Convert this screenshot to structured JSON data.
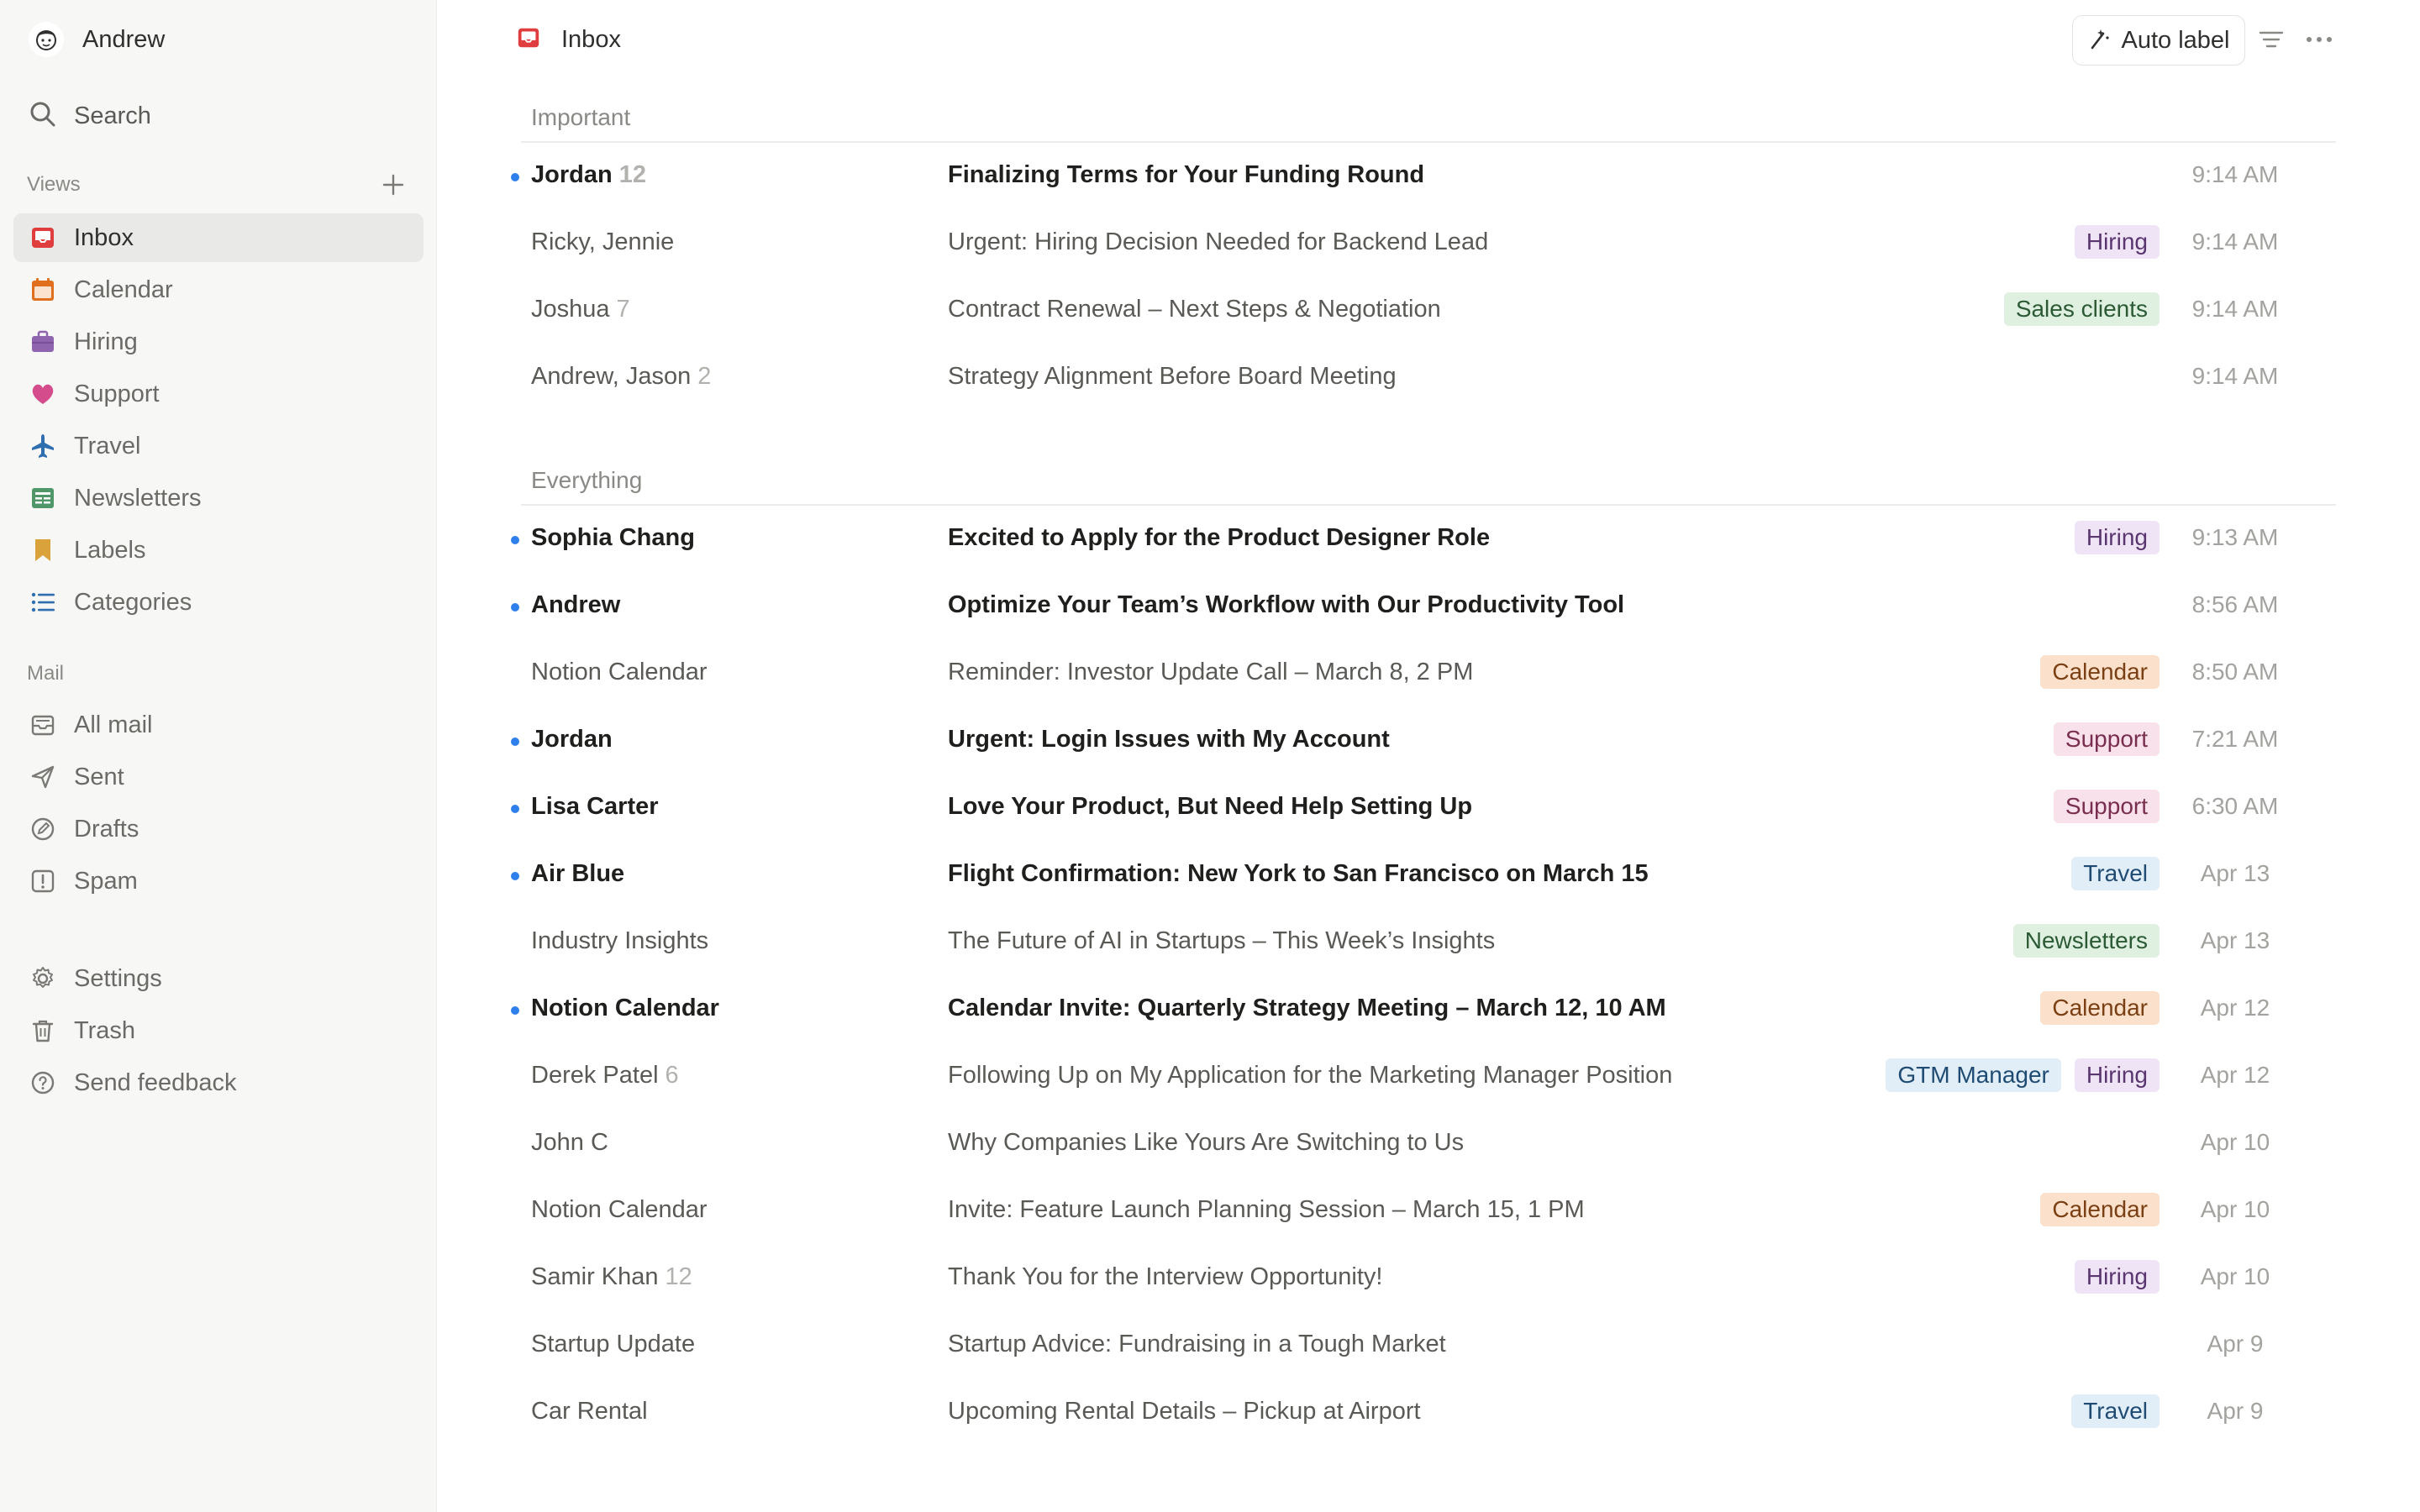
{
  "user": {
    "name": "Andrew"
  },
  "sidebar": {
    "search_label": "Search",
    "views_label": "Views",
    "mail_label": "Mail",
    "views": [
      {
        "label": "Inbox",
        "icon": "inbox-icon",
        "color": "#e03e3e",
        "active": true
      },
      {
        "label": "Calendar",
        "icon": "calendar-icon",
        "color": "#e0701e"
      },
      {
        "label": "Hiring",
        "icon": "briefcase-icon",
        "color": "#9065b0"
      },
      {
        "label": "Support",
        "icon": "heart-icon",
        "color": "#d44c8b"
      },
      {
        "label": "Travel",
        "icon": "airplane-icon",
        "color": "#2f6fb0"
      },
      {
        "label": "Newsletters",
        "icon": "newspaper-icon",
        "color": "#4f9768"
      },
      {
        "label": "Labels",
        "icon": "bookmark-icon",
        "color": "#d9a23a"
      },
      {
        "label": "Categories",
        "icon": "list-icon",
        "color": "#2f6fb0"
      }
    ],
    "mail": [
      {
        "label": "All mail",
        "icon": "all-mail-icon"
      },
      {
        "label": "Sent",
        "icon": "send-icon"
      },
      {
        "label": "Drafts",
        "icon": "drafts-icon"
      },
      {
        "label": "Spam",
        "icon": "spam-icon"
      }
    ],
    "footer": [
      {
        "label": "Settings",
        "icon": "gear-icon"
      },
      {
        "label": "Trash",
        "icon": "trash-icon"
      },
      {
        "label": "Send feedback",
        "icon": "help-icon"
      }
    ]
  },
  "header": {
    "title": "Inbox",
    "auto_label": "Auto label"
  },
  "tag_colors": {
    "Hiring": {
      "bg": "#efe4f5",
      "fg": "#5a3670"
    },
    "Sales clients": {
      "bg": "#dff0e1",
      "fg": "#2b5a35"
    },
    "Calendar": {
      "bg": "#fbe1cc",
      "fg": "#7a3f12"
    },
    "Support": {
      "bg": "#f8e1ea",
      "fg": "#7a2e4f"
    },
    "Travel": {
      "bg": "#e1eef8",
      "fg": "#1f4b73"
    },
    "Newsletters": {
      "bg": "#dff0e1",
      "fg": "#2b5a35"
    },
    "GTM Manager": {
      "bg": "#e1eef8",
      "fg": "#1f4b73"
    }
  },
  "groups": [
    {
      "title": "Important",
      "emails": [
        {
          "sender": "Jordan",
          "count": "12",
          "subject": "Finalizing Terms for Your Funding Round",
          "tags": [],
          "time": "9:14 AM",
          "unread": true
        },
        {
          "sender": "Ricky, Jennie",
          "count": "",
          "subject": "Urgent: Hiring Decision Needed for Backend Lead",
          "tags": [
            "Hiring"
          ],
          "time": "9:14 AM",
          "unread": false
        },
        {
          "sender": "Joshua",
          "count": "7",
          "subject": "Contract Renewal – Next Steps & Negotiation",
          "tags": [
            "Sales clients"
          ],
          "time": "9:14 AM",
          "unread": false
        },
        {
          "sender": "Andrew, Jason",
          "count": "2",
          "subject": "Strategy Alignment Before Board Meeting",
          "tags": [],
          "time": "9:14 AM",
          "unread": false
        }
      ]
    },
    {
      "title": "Everything",
      "emails": [
        {
          "sender": "Sophia Chang",
          "count": "",
          "subject": "Excited to Apply for the Product Designer Role",
          "tags": [
            "Hiring"
          ],
          "time": "9:13 AM",
          "unread": true
        },
        {
          "sender": "Andrew",
          "count": "",
          "subject": "Optimize Your Team’s Workflow with Our Productivity Tool",
          "tags": [],
          "time": "8:56 AM",
          "unread": true
        },
        {
          "sender": "Notion Calendar",
          "count": "",
          "subject": "Reminder: Investor Update Call – March 8, 2 PM",
          "tags": [
            "Calendar"
          ],
          "time": "8:50 AM",
          "unread": false
        },
        {
          "sender": "Jordan",
          "count": "",
          "subject": "Urgent: Login Issues with My Account",
          "tags": [
            "Support"
          ],
          "time": "7:21 AM",
          "unread": true
        },
        {
          "sender": "Lisa Carter",
          "count": "",
          "subject": "Love Your Product, But Need Help Setting Up",
          "tags": [
            "Support"
          ],
          "time": "6:30 AM",
          "unread": true
        },
        {
          "sender": "Air Blue",
          "count": "",
          "subject": "Flight Confirmation: New York to San Francisco on March 15",
          "tags": [
            "Travel"
          ],
          "time": "Apr 13",
          "unread": true
        },
        {
          "sender": "Industry Insights",
          "count": "",
          "subject": "The Future of AI in Startups – This Week’s Insights",
          "tags": [
            "Newsletters"
          ],
          "time": "Apr 13",
          "unread": false
        },
        {
          "sender": "Notion Calendar",
          "count": "",
          "subject": "Calendar Invite: Quarterly Strategy Meeting – March 12, 10 AM",
          "tags": [
            "Calendar"
          ],
          "time": "Apr 12",
          "unread": true
        },
        {
          "sender": "Derek Patel",
          "count": "6",
          "subject": "Following Up on My Application for the Marketing Manager Position",
          "tags": [
            "GTM Manager",
            "Hiring"
          ],
          "time": "Apr 12",
          "unread": false
        },
        {
          "sender": "John C",
          "count": "",
          "subject": "Why Companies Like Yours Are Switching to Us",
          "tags": [],
          "time": "Apr 10",
          "unread": false
        },
        {
          "sender": "Notion Calendar",
          "count": "",
          "subject": "Invite: Feature Launch Planning Session – March 15, 1 PM",
          "tags": [
            "Calendar"
          ],
          "time": "Apr 10",
          "unread": false
        },
        {
          "sender": "Samir Khan",
          "count": "12",
          "subject": "Thank You for the Interview Opportunity!",
          "tags": [
            "Hiring"
          ],
          "time": "Apr 10",
          "unread": false
        },
        {
          "sender": "Startup Update",
          "count": "",
          "subject": "Startup Advice: Fundraising in a Tough Market",
          "tags": [],
          "time": "Apr 9",
          "unread": false
        },
        {
          "sender": "Car Rental",
          "count": "",
          "subject": "Upcoming Rental Details – Pickup at Airport",
          "tags": [
            "Travel"
          ],
          "time": "Apr 9",
          "unread": false
        }
      ]
    }
  ]
}
